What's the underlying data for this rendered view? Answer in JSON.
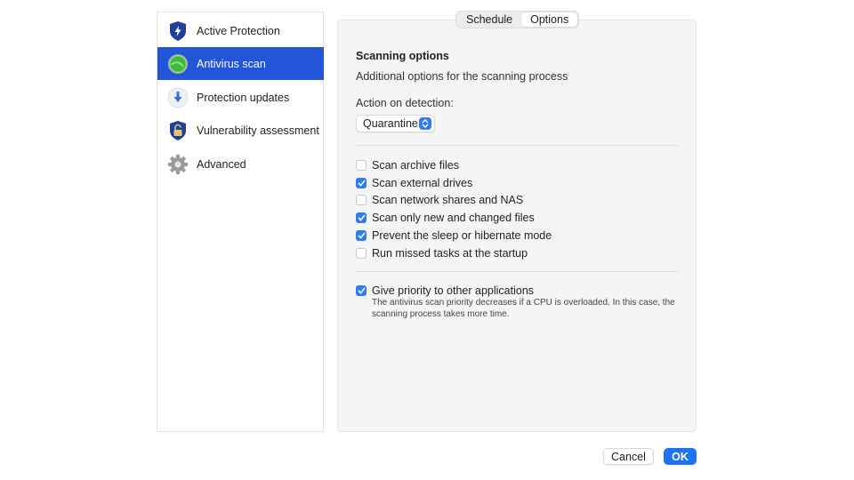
{
  "sidebar": {
    "items": [
      {
        "label": "Active Protection",
        "icon": "shield-bolt-icon",
        "active": false
      },
      {
        "label": "Antivirus scan",
        "icon": "antivirus-scan-icon",
        "active": true
      },
      {
        "label": "Protection updates",
        "icon": "download-arrow-icon",
        "active": false
      },
      {
        "label": "Vulnerability assessment",
        "icon": "shield-lock-icon",
        "active": false
      },
      {
        "label": "Advanced",
        "icon": "gear-icon",
        "active": false
      }
    ]
  },
  "tabs": [
    {
      "label": "Schedule",
      "selected": false
    },
    {
      "label": "Options",
      "selected": true
    }
  ],
  "options": {
    "title": "Scanning options",
    "subtitle": "Additional options for the scanning process",
    "action_label": "Action on detection:",
    "action_value": "Quarantine",
    "checkboxes": [
      {
        "label": "Scan archive files",
        "checked": false
      },
      {
        "label": "Scan external drives",
        "checked": true
      },
      {
        "label": "Scan network shares and NAS",
        "checked": false
      },
      {
        "label": "Scan only new and changed files",
        "checked": true
      },
      {
        "label": "Prevent the sleep or hibernate mode",
        "checked": true
      },
      {
        "label": "Run missed tasks at the startup",
        "checked": false
      }
    ],
    "priority": {
      "label": "Give priority to other applications",
      "checked": true,
      "note": "The antivirus scan priority decreases if a CPU is overloaded. In this case, the scanning process takes more time."
    }
  },
  "buttons": {
    "cancel": "Cancel",
    "ok": "OK"
  },
  "colors": {
    "accent": "#2355d8",
    "checkbox": "#2f7bf3",
    "ok_button": "#1f73f0"
  }
}
